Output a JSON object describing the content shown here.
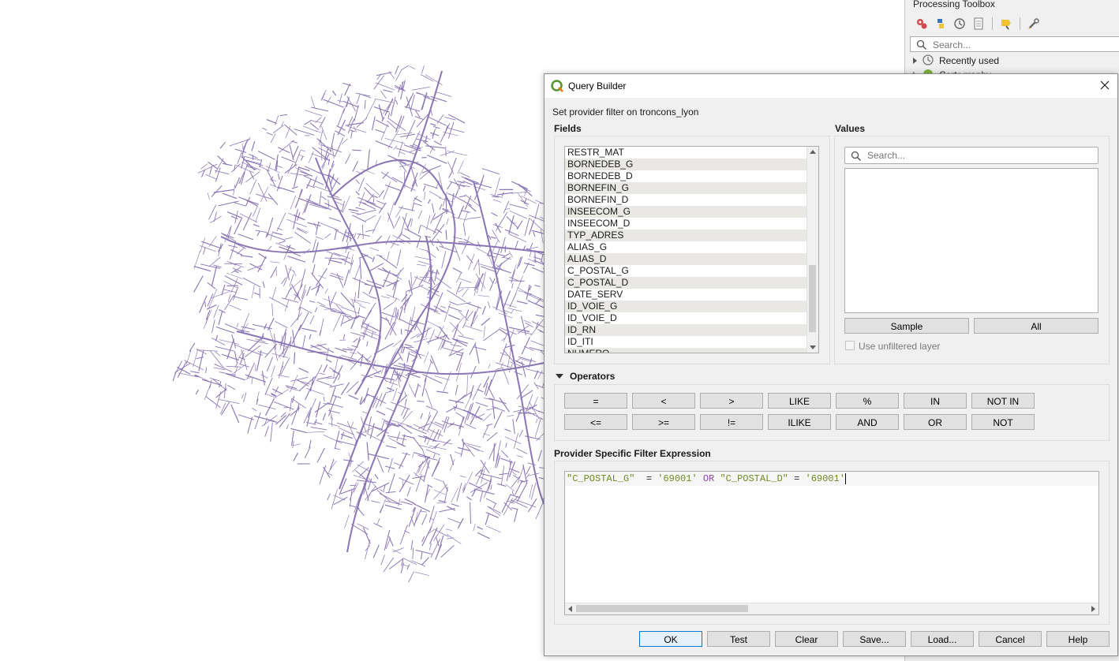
{
  "toolbox": {
    "title": "Processing Toolbox",
    "search_placeholder": "Search...",
    "tree": [
      {
        "label": "Recently used"
      },
      {
        "label": "Cartography"
      }
    ]
  },
  "dialog": {
    "title": "Query Builder",
    "provider_label": "Set provider filter on troncons_lyon",
    "fields_label": "Fields",
    "values_label": "Values",
    "fields": [
      "RESTR_MAT",
      "BORNEDEB_G",
      "BORNEDEB_D",
      "BORNEFIN_G",
      "BORNEFIN_D",
      "INSEECOM_G",
      "INSEECOM_D",
      "TYP_ADRES",
      "ALIAS_G",
      "ALIAS_D",
      "C_POSTAL_G",
      "C_POSTAL_D",
      "DATE_SERV",
      "ID_VOIE_G",
      "ID_VOIE_D",
      "ID_RN",
      "ID_ITI",
      "NUMERO"
    ],
    "values_search_placeholder": "Search...",
    "sample_button": "Sample",
    "all_button": "All",
    "use_unfiltered": "Use unfiltered layer",
    "operators_label": "Operators",
    "operators_row1": [
      "=",
      "<",
      ">",
      "LIKE",
      "%",
      "IN",
      "NOT IN"
    ],
    "operators_row2": [
      "<=",
      ">=",
      "!=",
      "ILIKE",
      "AND",
      "OR",
      "NOT"
    ],
    "expression_label": "Provider Specific Filter Expression",
    "expression": {
      "part1": "\"C_POSTAL_G\"",
      "part2": "  = ",
      "part3": "'69001'",
      "part4": " OR ",
      "part5": "\"C_POSTAL_D\"",
      "part6": " = ",
      "part7": "'69001'"
    },
    "buttons": {
      "ok": "OK",
      "test": "Test",
      "clear": "Clear",
      "save": "Save...",
      "load": "Load...",
      "cancel": "Cancel",
      "help": "Help"
    }
  },
  "colors": {
    "road_lines": "#8a76b5",
    "string_token": "#6e8b21",
    "keyword_token": "#8b44ac",
    "default_button_border": "#0078d7"
  }
}
